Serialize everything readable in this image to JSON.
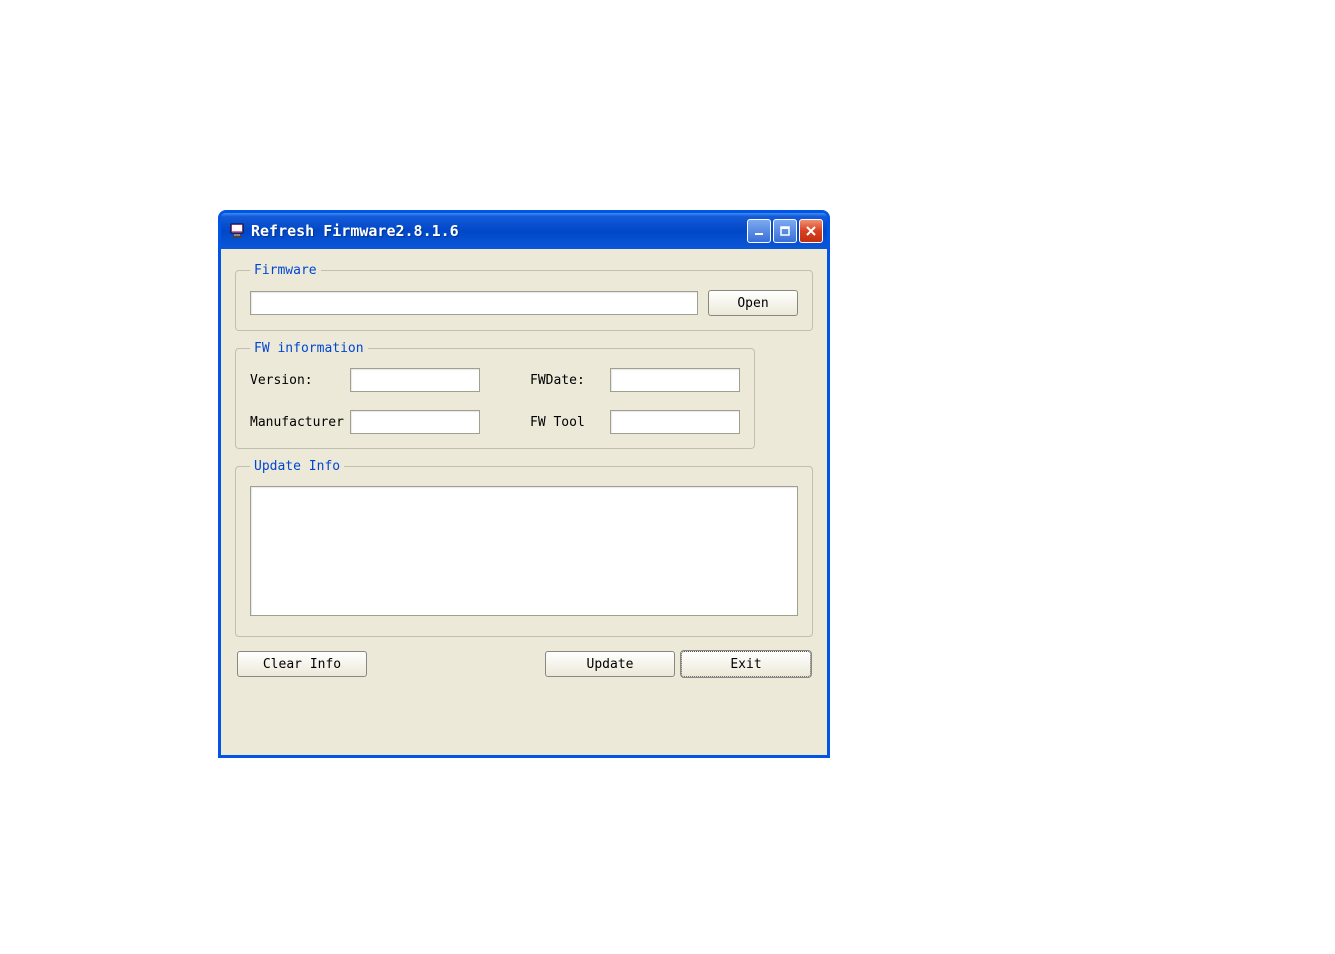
{
  "window": {
    "title": "Refresh Firmware2.8.1.6"
  },
  "firmware_group": {
    "legend": "Firmware",
    "path_value": "",
    "open_button": "Open"
  },
  "fwinfo_group": {
    "legend": "FW information",
    "version_label": "Version:",
    "version_value": "",
    "fwdate_label": "FWDate:",
    "fwdate_value": "",
    "manufacturer_label": "Manufacturer",
    "manufacturer_value": "",
    "fwtool_label": "FW Tool",
    "fwtool_value": ""
  },
  "updateinfo_group": {
    "legend": "Update Info",
    "content": ""
  },
  "buttons": {
    "clear_info": "Clear Info",
    "update": "Update",
    "exit": "Exit"
  }
}
